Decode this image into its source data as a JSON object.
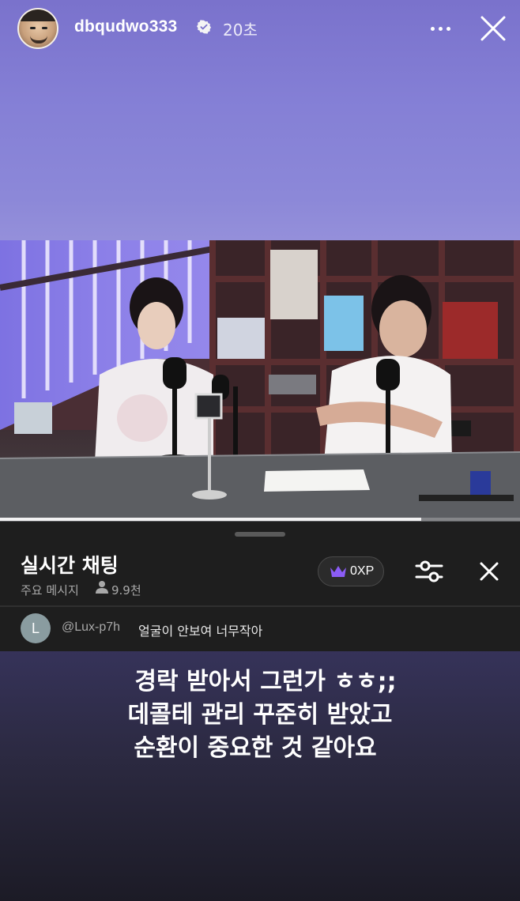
{
  "story": {
    "username": "dbqudwo333",
    "time": "20초",
    "progress": 0.81
  },
  "chat": {
    "title": "실시간 채팅",
    "subtitle": "주요 메시지",
    "viewers": "9.9천",
    "xp": "0XP",
    "message": {
      "avatar_letter": "L",
      "author": "@Lux-p7h",
      "text": "얼굴이 안보여 너무작아"
    }
  },
  "caption": {
    "line1": "경락 받아서 그런가 ㅎㅎ;;",
    "line2": "데콜테 관리 꾸준히 받았고",
    "line3": "순환이 중요한 것 같아요"
  },
  "colors": {
    "story_top": "#8c88d8",
    "story_bottom": "#1c1b26",
    "chat_bg": "#1e1e1e",
    "crown": "#8b5cf6"
  },
  "icons": [
    "verified-badge-icon",
    "more-options-icon",
    "close-icon",
    "person-icon",
    "crown-icon",
    "filter-sliders-icon",
    "chat-close-icon"
  ]
}
